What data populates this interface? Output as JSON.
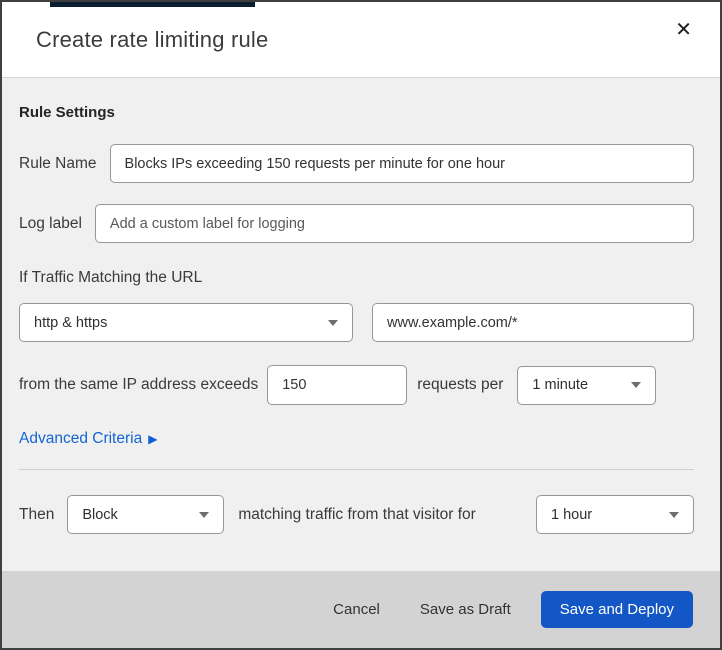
{
  "colors": {
    "primary_button_blue": "#1356c6",
    "link_blue": "#1465d3",
    "footer_gray": "#d3d3d3",
    "body_gray": "#f0f0f0",
    "top_strip_navy": "#0a1e30"
  },
  "icons": {
    "close": "✕",
    "arrow_right": "▶",
    "caret_down": "▼"
  },
  "modal": {
    "title": "Create rate limiting rule"
  },
  "form": {
    "section_title": "Rule Settings",
    "rule_name": {
      "label": "Rule Name",
      "value": "Blocks IPs exceeding 150 requests per minute for one hour"
    },
    "log_label": {
      "label": "Log label",
      "placeholder": "Add a custom label for logging"
    },
    "traffic_match": {
      "heading": "If Traffic Matching the URL",
      "scheme_selected": "http & https",
      "url_value": "www.example.com/*"
    },
    "threshold": {
      "prefix": "from the same IP address exceeds",
      "count_value": "150",
      "middle": "requests per",
      "period_selected": "1 minute"
    },
    "advanced_link_label": "Advanced Criteria",
    "action": {
      "prefix": "Then",
      "action_selected": "Block",
      "middle": "matching traffic from that visitor for",
      "duration_selected": "1 hour"
    }
  },
  "footer": {
    "cancel_label": "Cancel",
    "save_draft_label": "Save as Draft",
    "save_deploy_label": "Save and Deploy"
  }
}
